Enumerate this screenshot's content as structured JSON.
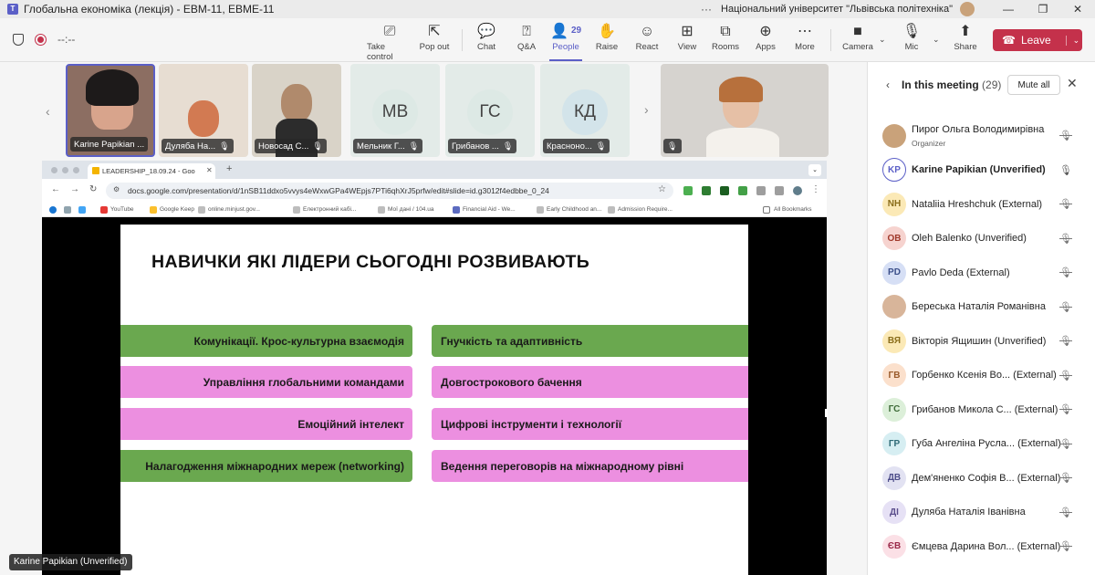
{
  "window": {
    "title": "Глобальна економіка (лекція) - ЕВМ-11, ЕВМЕ-11",
    "org": "Національний університет \"Львівська політехніка\"",
    "more": "···",
    "minimize": "—",
    "restore": "❐",
    "close": "✕"
  },
  "toolbar": {
    "timer": "--:--",
    "people_count": "29",
    "buttons": {
      "take_control": "Take control",
      "pop_out": "Pop out",
      "chat": "Chat",
      "qa": "Q&A",
      "people": "People",
      "raise": "Raise",
      "react": "React",
      "view": "View",
      "rooms": "Rooms",
      "apps": "Apps",
      "more": "More",
      "camera": "Camera",
      "mic": "Mic",
      "share": "Share",
      "leave": "Leave"
    }
  },
  "tiles": [
    {
      "name": "Karine Papikian ...",
      "type": "video"
    },
    {
      "name": "Дуляба На...",
      "type": "video"
    },
    {
      "name": "Новосад С...",
      "type": "video"
    },
    {
      "name": "Мельник Г...",
      "initials": "МВ"
    },
    {
      "name": "Грибанов ...",
      "initials": "ГС"
    },
    {
      "name": "Красноно...",
      "initials": "КД"
    }
  ],
  "browser": {
    "tab_title": "LEADERSHIP_18.09.24 - Goo",
    "url": "docs.google.com/presentation/d/1nSB11ddxo5vvys4eWxwGPa4WEpjs7PTi6qhXrJ5prfw/edit#slide=id.g3012f4edbbe_0_24",
    "bookmarks": [
      "YouTube",
      "Google Keep",
      "online.minjust.gov...",
      "Електронний кабі...",
      "Мої дані / 104.ua",
      "Financial Aid - We...",
      "Early Childhood an...",
      "Admission Require..."
    ],
    "all_bookmarks": "All Bookmarks"
  },
  "slide": {
    "title": "НАВИЧКИ ЯКІ ЛІДЕРИ СЬОГОДНІ РОЗВИВАЮТЬ",
    "left": [
      {
        "text": "Комунікації. Крос-культурна взаємодія",
        "color": "#6aa84f"
      },
      {
        "text": "Управління глобальними командами",
        "color": "#ec8fe0"
      },
      {
        "text": "Емоційний інтелект",
        "color": "#ec8fe0"
      },
      {
        "text": "Налагодження міжнародних мереж (networking)",
        "color": "#6aa84f"
      }
    ],
    "right": [
      {
        "text": "Гнучкість та адаптивність",
        "color": "#6aa84f"
      },
      {
        "text": "Довгострокового бачення",
        "color": "#ec8fe0"
      },
      {
        "text": "Цифрові інструменти і технології",
        "color": "#ec8fe0"
      },
      {
        "text": "Ведення переговорів на міжнародному рівні",
        "color": "#ec8fe0"
      }
    ]
  },
  "presenter": "Karine Papikian (Unverified)",
  "panel": {
    "title": "In this meeting",
    "count": "(29)",
    "mute_all": "Mute all",
    "participants": [
      {
        "name": "Пирог Ольга Володимирівна",
        "sub": "Organizer",
        "initials": "",
        "bg": "#c9a27a",
        "mic": "off"
      },
      {
        "name": "Karine Papikian (Unverified)",
        "initials": "KP",
        "bg": "#ffffff",
        "fg": "#5b5fc7",
        "mic": "on",
        "bold": true
      },
      {
        "name": "Nataliia Hreshchuk (External)",
        "initials": "NH",
        "bg": "#fbe9b6",
        "fg": "#8a6d1a",
        "mic": "off"
      },
      {
        "name": "Oleh Balenko (Unverified)",
        "initials": "OB",
        "bg": "#f6d3cf",
        "fg": "#a0382a",
        "mic": "off"
      },
      {
        "name": "Pavlo Deda (External)",
        "initials": "PD",
        "bg": "#d6dff5",
        "fg": "#3b4f8a",
        "mic": "off"
      },
      {
        "name": "Береська Наталія Романівна",
        "initials": "",
        "bg": "#d8b59a",
        "mic": "off"
      },
      {
        "name": "Вікторія Ящишин (Unverified)",
        "initials": "ВЯ",
        "bg": "#fbe9b6",
        "fg": "#8a6d1a",
        "mic": "off"
      },
      {
        "name": "Горбенко Ксенія Во... (External)",
        "initials": "ГВ",
        "bg": "#fbe0cc",
        "fg": "#9a5a2a",
        "mic": "off"
      },
      {
        "name": "Грибанов Микола С... (External)",
        "initials": "ГС",
        "bg": "#dcefd9",
        "fg": "#3e6b38",
        "mic": "off"
      },
      {
        "name": "Губа Ангеліна Русла... (External)",
        "initials": "ГР",
        "bg": "#d6eef2",
        "fg": "#2d6a76",
        "mic": "off"
      },
      {
        "name": "Дем'яненко Софія В... (External)",
        "initials": "ДВ",
        "bg": "#e2e2f2",
        "fg": "#4d4d8a",
        "mic": "off"
      },
      {
        "name": "Дуляба Наталія Іванівна",
        "initials": "ДІ",
        "bg": "#e6e1f5",
        "fg": "#5b4e8c",
        "mic": "off"
      },
      {
        "name": "Ємцева Дарина Вол... (External)",
        "initials": "ЄВ",
        "bg": "#fbe0e6",
        "fg": "#9a2a4a",
        "mic": "off"
      }
    ]
  }
}
